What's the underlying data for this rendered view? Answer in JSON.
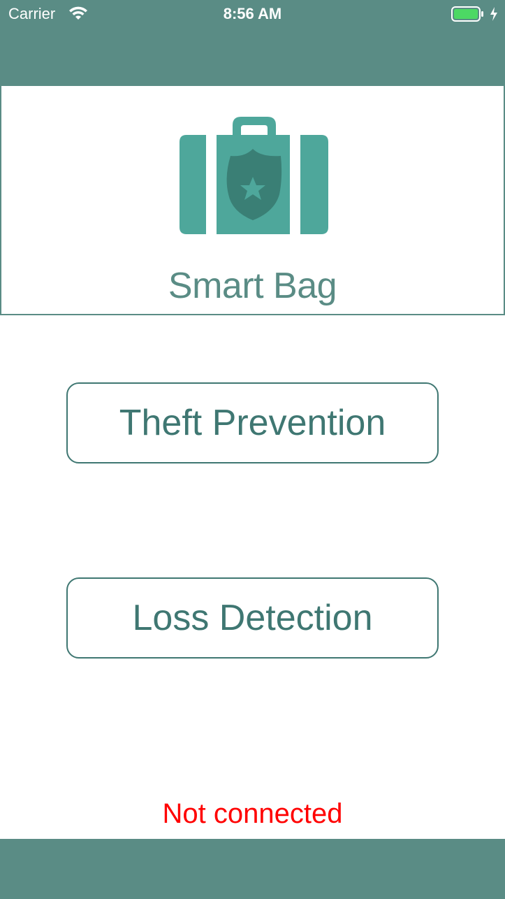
{
  "status_bar": {
    "carrier": "Carrier",
    "time": "8:56 AM",
    "icons": [
      "wifi-icon",
      "battery-icon",
      "charging-bolt-icon"
    ]
  },
  "header": {
    "logo_icon": "suitcase-shield-icon",
    "title": "Smart Bag"
  },
  "buttons": {
    "theft_prevention": "Theft Prevention",
    "loss_detection": "Loss Detection"
  },
  "connection": {
    "status": "Not connected",
    "color": "#ff0000"
  },
  "colors": {
    "bar": "#5a8c85",
    "accent": "#3f7772",
    "logo": "#4ea79b",
    "logo_dark": "#3a7f75",
    "battery": "#4cd964"
  }
}
